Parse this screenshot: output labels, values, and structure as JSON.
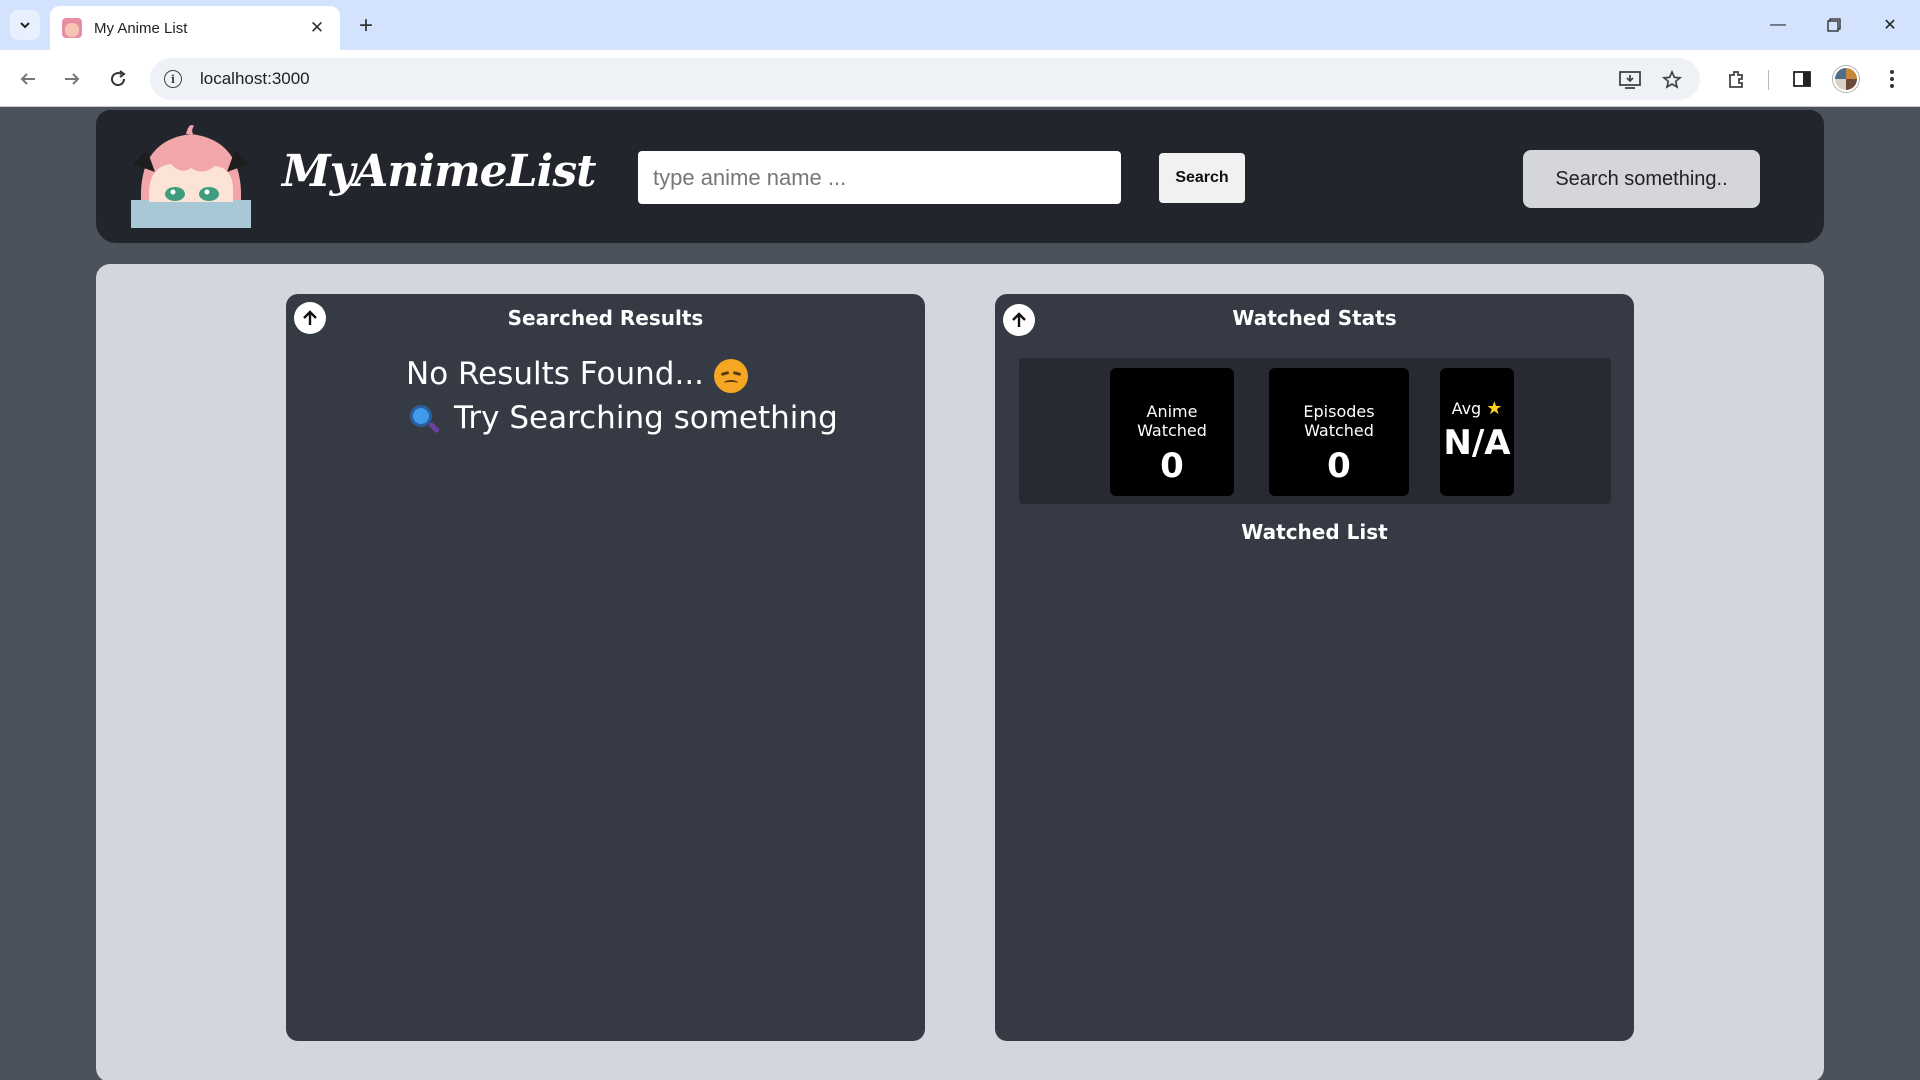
{
  "browser": {
    "tab_title": "My Anime List",
    "url": "localhost:3000"
  },
  "header": {
    "logo_text": "MyAnimeList",
    "search_placeholder": "type anime name ...",
    "search_button_label": "Search",
    "status_text": "Search something.."
  },
  "searched_results": {
    "title": "Searched Results",
    "empty_line1": "No Results Found...",
    "empty_line2": "Try Searching something"
  },
  "watched_stats": {
    "title": "Watched Stats",
    "cards": [
      {
        "label": "Anime Watched",
        "value": "0"
      },
      {
        "label": "Episodes Watched",
        "value": "0"
      },
      {
        "label": "Avg",
        "value": "N/A",
        "icon": "star-icon"
      }
    ],
    "list_title": "Watched List"
  },
  "colors": {
    "header_bg": "#22252b",
    "content_bg": "#d3d6dd",
    "panel_bg": "#353a44",
    "star": "#ffd21e"
  }
}
